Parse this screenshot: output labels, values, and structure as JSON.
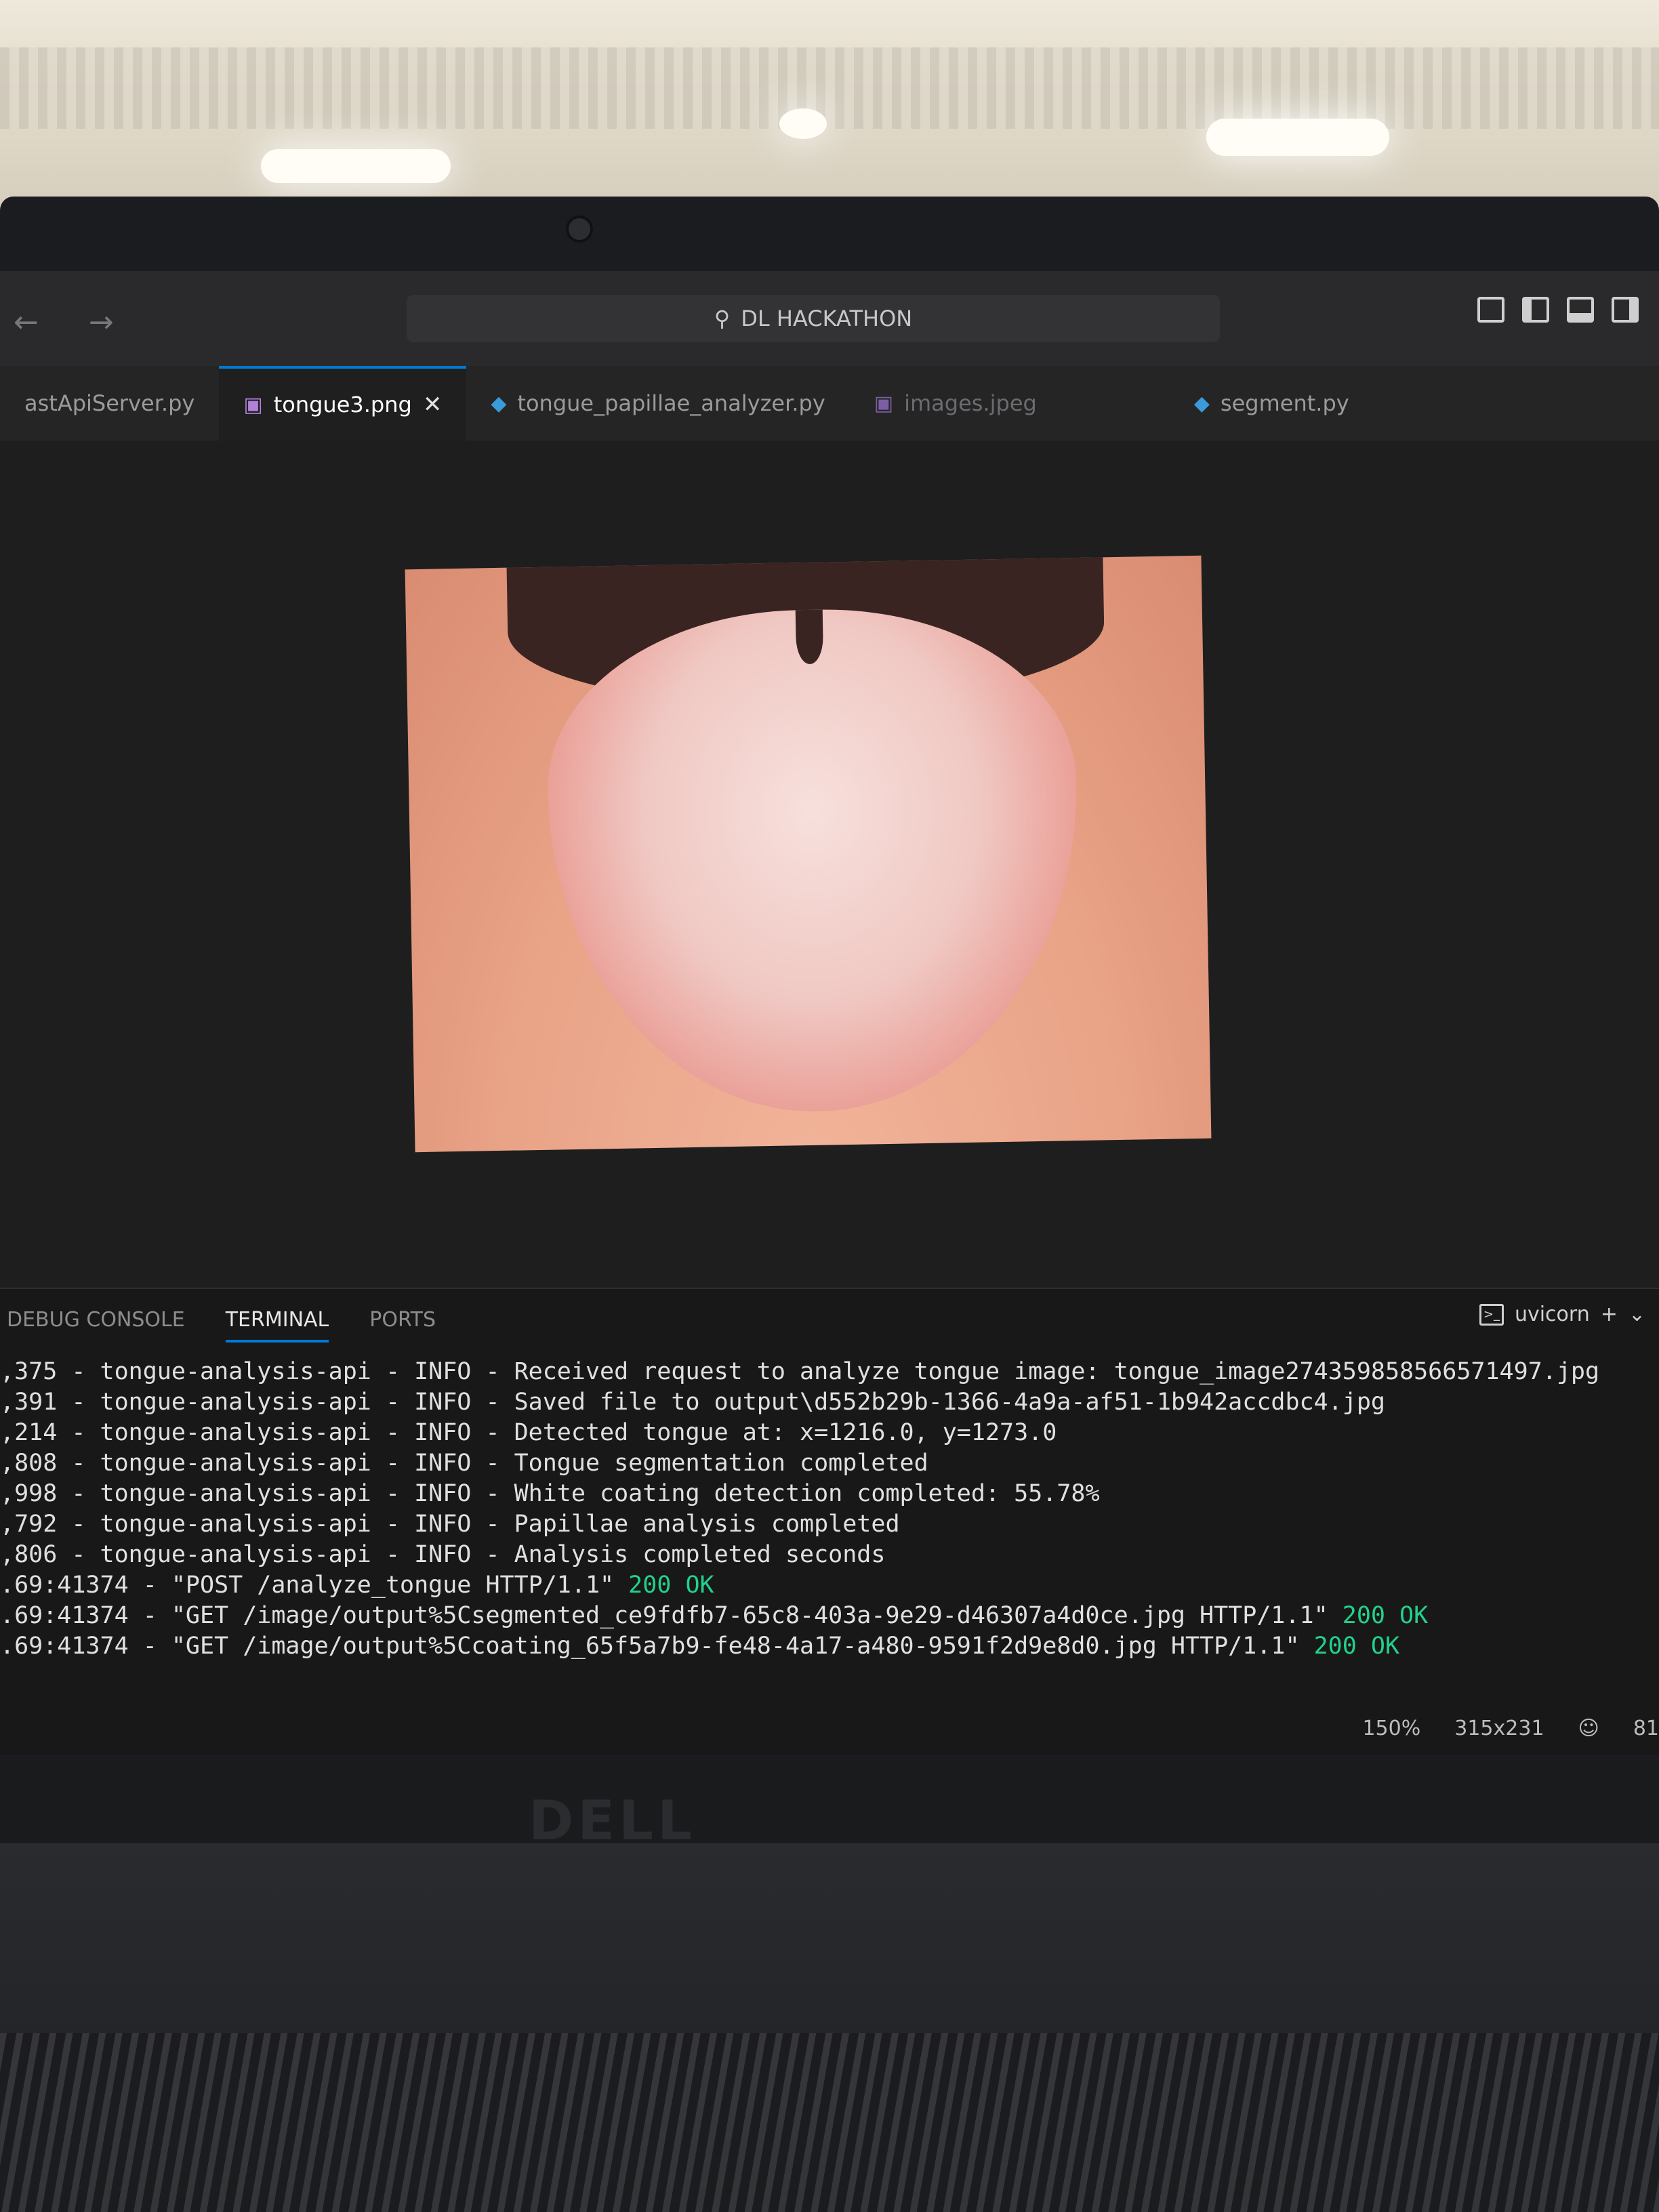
{
  "titlebar": {
    "nav_arrows": "← →",
    "search_text": "DL HACKATHON"
  },
  "tabs": [
    {
      "label": "astApiServer.py"
    },
    {
      "label": "tongue3.png"
    },
    {
      "label": "tongue_papillae_analyzer.py"
    },
    {
      "label": "images.jpeg"
    },
    {
      "label": "segment.py"
    }
  ],
  "panel": {
    "tabs": [
      "DEBUG CONSOLE",
      "TERMINAL",
      "PORTS"
    ],
    "shell_label": "uvicorn",
    "add_label": "+",
    "dropdown_label": "⌄"
  },
  "terminal_lines": [
    {
      "text": ",375 - tongue-analysis-api - INFO - Received request to analyze tongue image: tongue_image274359858566571497.jpg",
      "status": ""
    },
    {
      "text": ",391 - tongue-analysis-api - INFO - Saved file to output\\d552b29b-1366-4a9a-af51-1b942accdbc4.jpg",
      "status": ""
    },
    {
      "text": ",214 - tongue-analysis-api - INFO - Detected tongue at: x=1216.0, y=1273.0",
      "status": ""
    },
    {
      "text": ",808 - tongue-analysis-api - INFO - Tongue segmentation completed",
      "status": ""
    },
    {
      "text": ",998 - tongue-analysis-api - INFO - White coating detection completed: 55.78%",
      "status": ""
    },
    {
      "text": ",792 - tongue-analysis-api - INFO - Papillae analysis completed",
      "status": ""
    },
    {
      "text": ",806 - tongue-analysis-api - INFO - Analysis completed seconds",
      "status": ""
    },
    {
      "text": ".69:41374 - \"POST /analyze_tongue HTTP/1.1\" ",
      "status": "200 OK"
    },
    {
      "text": ".69:41374 - \"GET /image/output%5Csegmented_ce9fdfb7-65c8-403a-9e29-d46307a4d0ce.jpg HTTP/1.1\" ",
      "status": "200 OK"
    },
    {
      "text": ".69:41374 - \"GET /image/output%5Ccoating_65f5a7b9-fe48-4a17-a480-9591f2d9e8d0.jpg HTTP/1.1\" ",
      "status": "200 OK"
    }
  ],
  "statusbar": {
    "zoom": "150%",
    "dimensions": "315x231",
    "copilot_icon": "copilot-icon",
    "trailing": "81"
  },
  "laptop": {
    "brand": "DELL"
  },
  "colors": {
    "accent": "#0078d4",
    "ok_green": "#23d18b"
  }
}
